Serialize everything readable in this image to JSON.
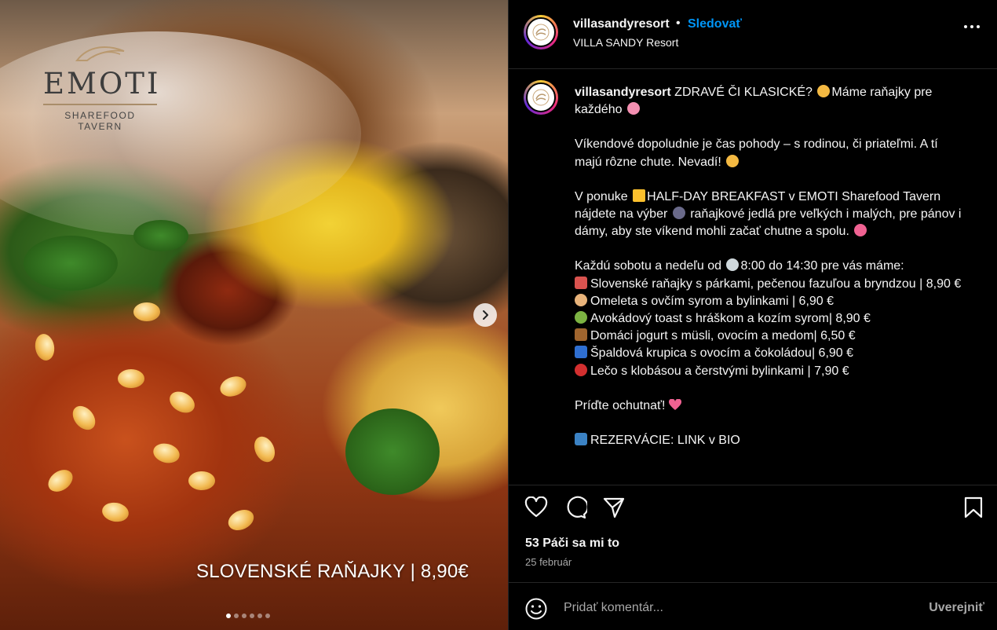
{
  "media": {
    "logo": {
      "name": "EMOTI",
      "subtitle": "SHAREFOOD TAVERN"
    },
    "overlay_caption": "SLOVENSKÉ RAŇAJKY | 8,90€",
    "carousel": {
      "slides": 6,
      "current": 1
    }
  },
  "header": {
    "username": "villasandyresort",
    "separator": "•",
    "follow_label": "Sledovať",
    "location": "VILLA SANDY Resort"
  },
  "post": {
    "username": "villasandyresort",
    "line1_text": " ZDRAVÉ ČI KLASICKÉ? ",
    "line1_tail": "Máme raňajky pre každého ",
    "para2": "Víkendové dopoludnie je čas pohody – s rodinou, či priateľmi. A tí majú rôzne chute. Nevadí! ",
    "para3_a": "V ponuke ",
    "para3_b": "HALF-DAY BREAKFAST v EMOTI Sharefood Tavern nájdete na výber ",
    "para3_c": " raňajkové jedlá pre veľkých i malých, pre pánov i dámy, aby ste víkend mohli začať chutne a spolu. ",
    "schedule_a": "Každú sobotu a nedeľu od ",
    "schedule_b": "8:00 do 14:30 pre vás máme:",
    "menu": [
      {
        "text": "Slovenské raňajky s párkami, pečenou fazuľou a bryndzou | 8,90 €",
        "emoji_color": "#d9534f"
      },
      {
        "text": "Omeleta s ovčím syrom a bylinkami | 6,90 €",
        "emoji_color": "#e8b37a"
      },
      {
        "text": "Avokádový toast s hráškom a kozím syrom| 8,90 €",
        "emoji_color": "#7cb342"
      },
      {
        "text": "Domáci jogurt s müsli, ovocím a medom| 6,50 €",
        "emoji_color": "#a0652e"
      },
      {
        "text": "Špaldová krupica s ovocím a čokoládou| 6,90 €",
        "emoji_color": "#2f6fd1"
      },
      {
        "text": "Lečo s klobásou a čerstvými bylinkami | 7,90 €",
        "emoji_color": "#d32f2f"
      }
    ],
    "closing": "Príďte ochutnať! ",
    "reservation": "REZERVÁCIE: LINK v BIO"
  },
  "actions": {
    "likes": "53 Páči sa mi to",
    "date": "25 február"
  },
  "comment": {
    "placeholder": "Pridať komentár...",
    "publish_label": "Uverejniť"
  },
  "colors": {
    "background": "#000000",
    "text": "#f5f5f5",
    "secondary_text": "#a8a8a8",
    "link": "#0095f6",
    "divider": "#262626"
  }
}
